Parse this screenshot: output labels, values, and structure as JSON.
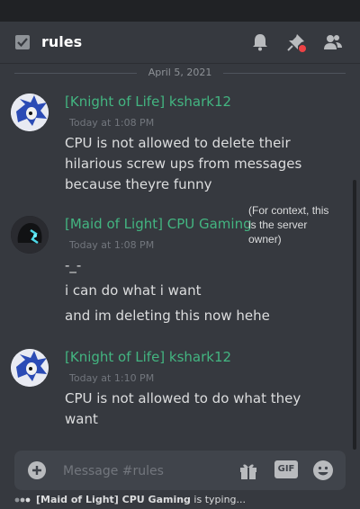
{
  "channel": {
    "name": "rules"
  },
  "date_divider": "April 5, 2021",
  "messages": [
    {
      "author": "[Knight of Life] kshark12",
      "timestamp": "Today at 1:08 PM",
      "lines": [
        "CPU is not allowed to delete their",
        "hilarious screw ups from messages",
        "because theyre funny"
      ]
    },
    {
      "author": "[Maid of Light] CPU Gaming",
      "timestamp": "Today at 1:08 PM",
      "lines": [
        "-_-",
        "i can do what i want",
        "and im deleting this now hehe"
      ]
    },
    {
      "author": "[Knight of Life] kshark12",
      "timestamp": "Today at 1:10 PM",
      "lines": [
        "CPU is not allowed to do what they",
        "want"
      ]
    }
  ],
  "annotation": [
    "(For context, this",
    "is the server",
    "owner)"
  ],
  "composer": {
    "placeholder": "Message #rules",
    "gif_label": "GIF"
  },
  "typing": {
    "user": "[Maid of Light] CPU Gaming",
    "suffix": " is typing..."
  },
  "icons": {
    "channel": "text-channel-icon",
    "notifications": "bell-icon",
    "pins": "pin-icon",
    "members": "member-list-icon",
    "add": "add-attachment-icon",
    "gift": "gift-icon",
    "emoji": "emoji-icon"
  },
  "colors": {
    "author_name": "#43b581",
    "background": "#36393f",
    "alert_dot": "#ed4245"
  }
}
